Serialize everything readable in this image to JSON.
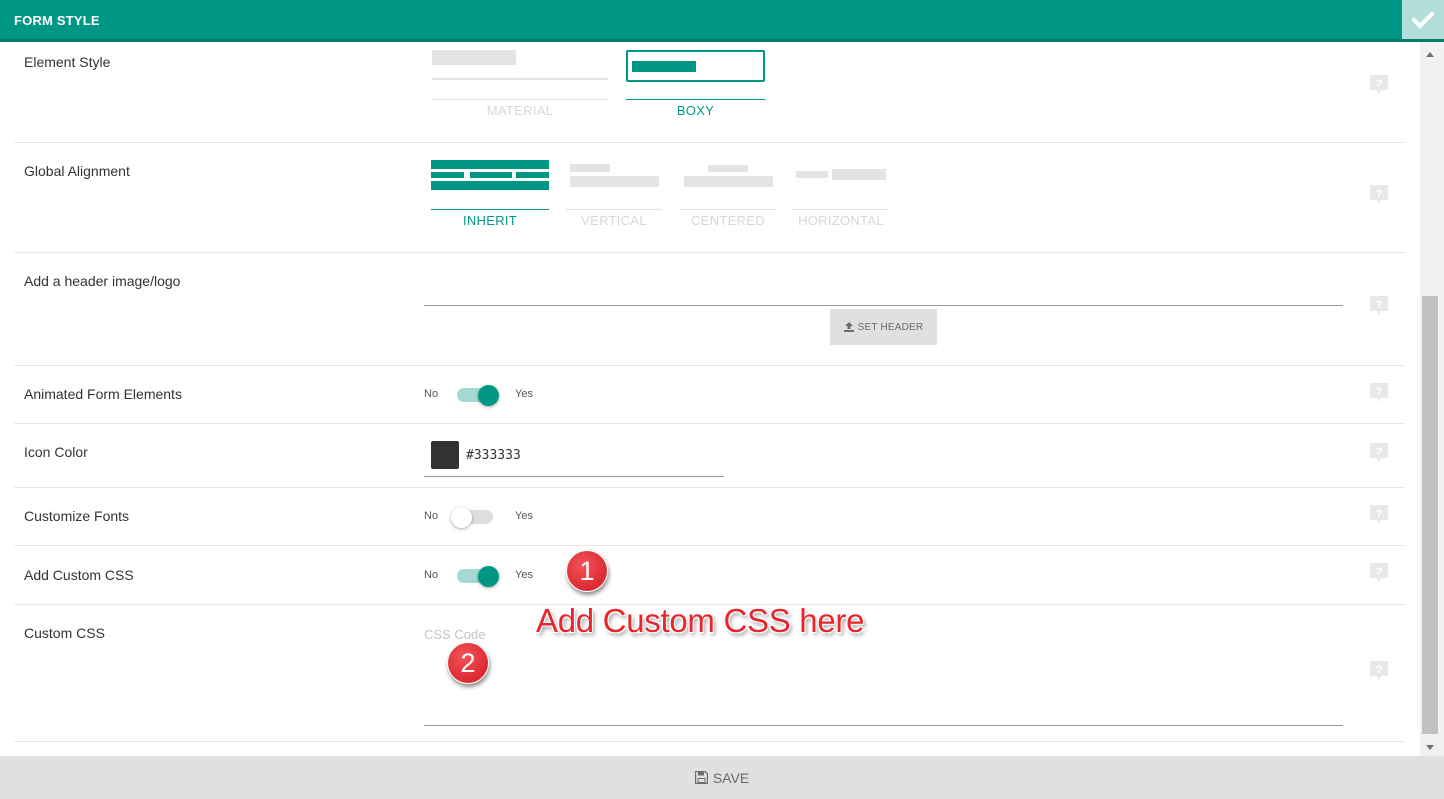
{
  "header": {
    "title": "FORM STYLE",
    "confirm_icon": "check-icon"
  },
  "colors": {
    "accent": "#009684",
    "accent_light": "#a4d9d2",
    "muted": "#d7d7d7",
    "badge_red": "#e8262e",
    "icon_color": "#333333"
  },
  "rows": {
    "element_style": {
      "label": "Element Style",
      "options": [
        "MATERIAL",
        "BOXY"
      ],
      "selected": "BOXY"
    },
    "global_alignment": {
      "label": "Global Alignment",
      "options": [
        "INHERIT",
        "VERTICAL",
        "CENTERED",
        "HORIZONTAL"
      ],
      "selected": "INHERIT"
    },
    "header_image": {
      "label": "Add a header image/logo",
      "button_label": "SET HEADER",
      "button_icon": "upload-icon"
    },
    "animated": {
      "label": "Animated Form Elements",
      "no": "No",
      "yes": "Yes",
      "enabled": true
    },
    "icon_color": {
      "label": "Icon Color",
      "value": "#333333"
    },
    "customize_fonts": {
      "label": "Customize Fonts",
      "no": "No",
      "yes": "Yes",
      "enabled": false
    },
    "custom_css_toggle": {
      "label": "Add Custom CSS",
      "no": "No",
      "yes": "Yes",
      "enabled": true
    },
    "custom_css": {
      "label": "Custom CSS",
      "placeholder": "CSS Code"
    }
  },
  "help_icon": "help-bubble-icon",
  "annotations": {
    "badge_1": "1",
    "badge_2": "2",
    "callout": "Add Custom CSS here"
  },
  "footer": {
    "save_label": "SAVE",
    "save_icon": "floppy-disk-icon"
  }
}
